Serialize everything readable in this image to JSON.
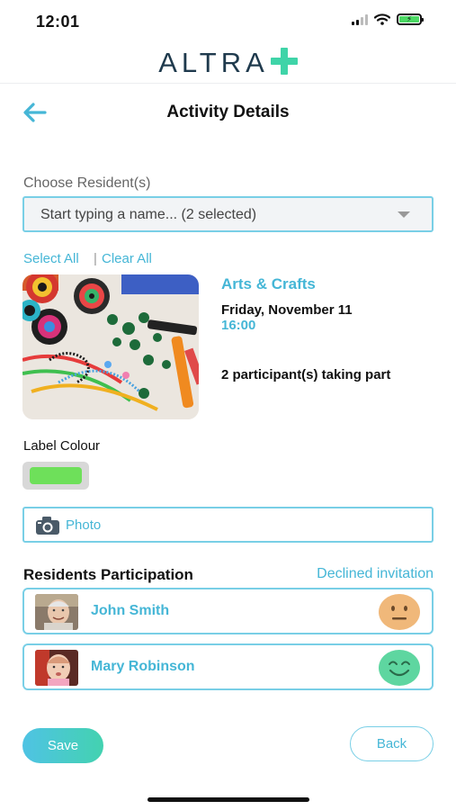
{
  "status_bar": {
    "time": "12:01",
    "icons": [
      "signal-icon",
      "wifi-icon",
      "battery-charging-icon"
    ],
    "battery_color": "#4cd964"
  },
  "header": {
    "logo_text": "ALTRA",
    "logo_accent": "#3fd4a8",
    "title": "Activity Details",
    "back_icon": "back-arrow-icon"
  },
  "residents": {
    "label": "Choose Resident(s)",
    "select_value": "Start typing a name... (2 selected)",
    "select_all": "Select All",
    "separator": "|",
    "clear_all": "Clear All"
  },
  "activity": {
    "name": "Arts & Crafts",
    "date": "Friday, November 11",
    "time": "16:00",
    "participants": "2 participant(s) taking part"
  },
  "label_colour": {
    "title": "Label Colour",
    "color": "#6ee05a"
  },
  "photo": {
    "label": "Photo",
    "icon": "camera-icon"
  },
  "participation": {
    "title": "Residents Participation",
    "declined_label": "Declined invitation",
    "residents": [
      {
        "name": "John Smith",
        "face": "neutral-face-icon",
        "face_color": "#f0b87a"
      },
      {
        "name": "Mary Robinson",
        "face": "happy-face-icon",
        "face_color": "#5ed6a0"
      }
    ]
  },
  "actions": {
    "save": "Save",
    "back": "Back"
  },
  "colors": {
    "accent": "#45b6d6",
    "border": "#79cfe6"
  }
}
